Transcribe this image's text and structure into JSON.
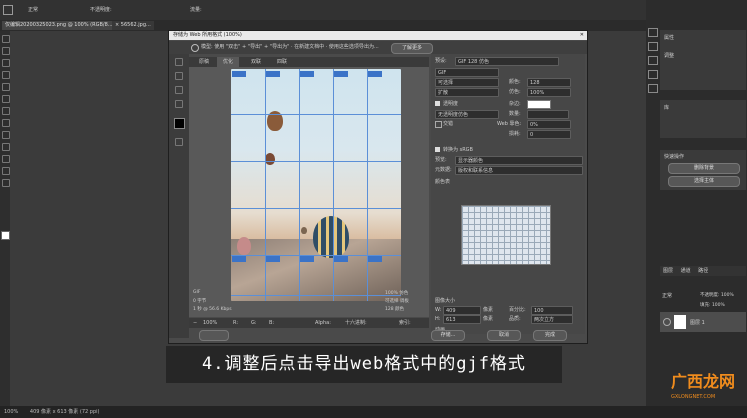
{
  "menubar": {
    "opacity_label": "不透明度:",
    "mode_value": "正常",
    "flow_label": "流量:"
  },
  "document_tabs": [
    {
      "label": "仅编辑20200325023.png @ 100% (RGB/8...)"
    },
    {
      "label": "× 56562.jpg..."
    }
  ],
  "dialog": {
    "title": "存储为 Web 所用格式 (100%)",
    "options_bar": "模型: 使用 \"双击\" + \"导出\" + \"导出为\" · 在新建文档中 · 使用这些选项导出为...",
    "options_button": "了解更多",
    "view_tabs": [
      "原稿",
      "优化",
      "双联",
      "四联"
    ],
    "active_view_tab": "优化",
    "info_left": [
      "GIF",
      "0 字节",
      "1 秒 @ 56.6 Kbps"
    ],
    "info_right": [
      "100% 仿色",
      "可选择 调板",
      "128 颜色"
    ],
    "zoom": "100%",
    "bottom_fields": {
      "r": "R:",
      "g": "G:",
      "b": "B:",
      "alpha": "Alpha:",
      "hex": "十六进制:",
      "index": "索引:"
    }
  },
  "settings": {
    "preset_label": "预设:",
    "preset_value": "GIF 128 仿色",
    "format_value": "GIF",
    "reduction_value": "可选择",
    "dither_value": "扩散",
    "colors_label": "颜色:",
    "colors_value": "128",
    "dither_label": "仿色:",
    "dither_pct": "100%",
    "transparency_label": "透明度",
    "matte_label": "杂边:",
    "no_dither": "无透明度仿色",
    "amount_label": "数量:",
    "interlaced_label": "交错",
    "web_snap_label": "Web 靠色:",
    "web_snap_value": "0%",
    "lossy_label": "损耗:",
    "lossy_value": "0",
    "convert_srgb": "转换为 sRGB",
    "preview_label": "预览:",
    "preview_value": "显示器颜色",
    "metadata_label": "元数据:",
    "metadata_value": "版权和联系信息",
    "color_table_label": "颜色表",
    "image_size_label": "图像大小",
    "w_label": "W:",
    "w_value": "409",
    "h_label": "H:",
    "h_value": "613",
    "px": "像素",
    "percent_label": "百分比:",
    "percent_value": "100",
    "quality_label": "品质:",
    "quality_value": "两次立方",
    "animation_label": "动画",
    "loop_label": "循环选项:",
    "loop_value": "永远"
  },
  "buttons": {
    "save": "存储...",
    "cancel": "取消",
    "done": "完成"
  },
  "caption": "4.调整后点击导出web格式中的gjf格式",
  "watermark": {
    "main": "广西龙网",
    "sub": "GXLONGNET.COM"
  },
  "right_panel": {
    "properties": "属性",
    "adjustments": "调整",
    "libraries": "库",
    "quick_actions": "快速操作",
    "remove_bg": "删除背景",
    "select_subject": "选择主体",
    "layers_tab": "图层",
    "channels_tab": "通道",
    "paths_tab": "路径",
    "layer_name": "图层 1",
    "blend_mode": "正常",
    "opacity": "不透明度: 100%",
    "fill": "填充: 100%"
  },
  "statusbar": {
    "zoom": "100%",
    "doc_info": "409 像素 x 613 像素 (72 ppi)",
    "timeline": "时间轴"
  },
  "colors": {
    "accent_blue": "#3b73c7",
    "caption_bg": "#262626",
    "watermark_orange": "#f08c1d"
  }
}
